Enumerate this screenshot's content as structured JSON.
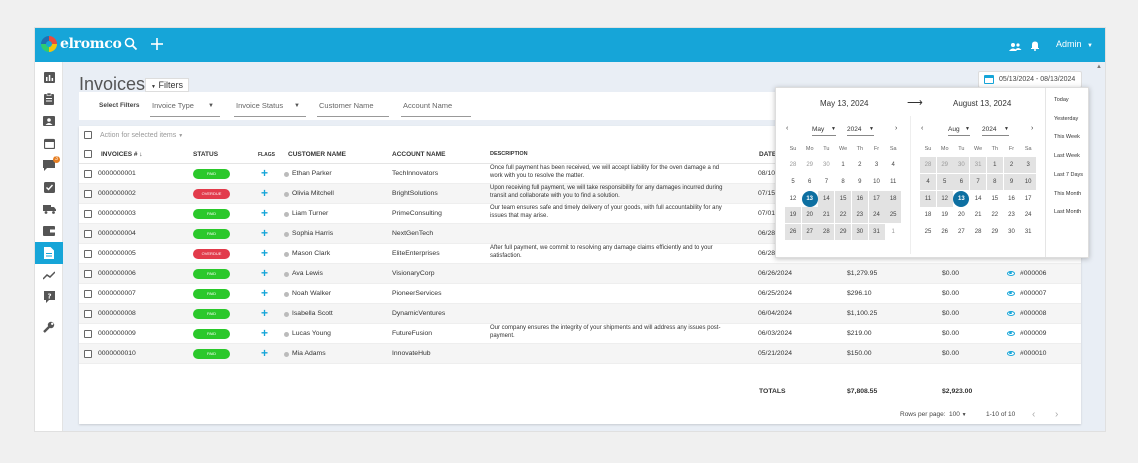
{
  "app": {
    "logo_text": "elromco",
    "admin_label": "Admin"
  },
  "icons": {
    "topbar": [
      "search-icon",
      "plus-icon",
      "users-icon",
      "bell-icon"
    ],
    "sidebar": [
      "chart-icon",
      "clipboard-icon",
      "contact-card-icon",
      "calendar-icon",
      "chat-icon",
      "checkbox-icon",
      "truck-icon",
      "wallet-icon",
      "document-icon",
      "trend-icon",
      "help-icon",
      "wrench-icon"
    ]
  },
  "sidebar": {
    "badge": "3",
    "active_index": 8
  },
  "page": {
    "title": "Invoices",
    "filters_button": "Filters"
  },
  "date_range": "05/13/2024 - 08/13/2024",
  "filters": {
    "label": "Select Filters",
    "invoice_type": "Invoice Type",
    "invoice_status": "Invoice Status",
    "customer_name": "Customer Name",
    "account_name": "Account Name"
  },
  "bulk_action": "Action for selected items",
  "columns": {
    "invoice": "INVOICES #",
    "status": "STATUS",
    "flags": "FLAGS",
    "customer": "CUSTOMER NAME",
    "account": "ACCOUNT NAME",
    "description": "DESCRIPTION",
    "date": "DATE"
  },
  "rows": [
    {
      "invoice": "0000000001",
      "status": "PAID",
      "customer": "Ethan Parker",
      "account": "TechInnovators",
      "description": "Once full payment has been received, we will accept liability for the oven damage a nd work with you to resolve the matter.",
      "date": "08/10",
      "amount": "",
      "paid": "",
      "ref": ""
    },
    {
      "invoice": "0000000002",
      "status": "OVERDUE",
      "customer": "Olivia Mitchell",
      "account": "BrightSolutions",
      "description": "Upon receiving full payment, we will take responsibility for any damages incurred during transit and collaborate with you to find a solution.",
      "date": "07/15",
      "amount": "",
      "paid": "",
      "ref": ""
    },
    {
      "invoice": "0000000003",
      "status": "PAID",
      "customer": "Liam Turner",
      "account": "PrimeConsulting",
      "description": "Our team ensures safe and timely delivery of your goods, with full accountability for any issues that may arise.",
      "date": "07/01",
      "amount": "",
      "paid": "",
      "ref": ""
    },
    {
      "invoice": "0000000004",
      "status": "PAID",
      "customer": "Sophia Harris",
      "account": "NextGenTech",
      "description": "",
      "date": "06/28",
      "amount": "",
      "paid": "",
      "ref": ""
    },
    {
      "invoice": "0000000005",
      "status": "OVERDUE",
      "customer": "Mason Clark",
      "account": "EliteEnterprises",
      "description": "After full payment, we commit to resolving any damage claims efficiently and to your satisfaction.",
      "date": "06/28",
      "amount": "",
      "paid": "",
      "ref": ""
    },
    {
      "invoice": "0000000006",
      "status": "PAID",
      "customer": "Ava Lewis",
      "account": "VisionaryCorp",
      "description": "",
      "date": "06/26/2024",
      "amount": "$1,279.95",
      "paid": "$0.00",
      "ref": "#000006"
    },
    {
      "invoice": "0000000007",
      "status": "PAID",
      "customer": "Noah Walker",
      "account": "PioneerServices",
      "description": "",
      "date": "06/25/2024",
      "amount": "$296.10",
      "paid": "$0.00",
      "ref": "#000007"
    },
    {
      "invoice": "0000000008",
      "status": "PAID",
      "customer": "Isabella Scott",
      "account": "DynamicVentures",
      "description": "",
      "date": "06/04/2024",
      "amount": "$1,100.25",
      "paid": "$0.00",
      "ref": "#000008"
    },
    {
      "invoice": "0000000009",
      "status": "PAID",
      "customer": "Lucas Young",
      "account": "FutureFusion",
      "description": "Our company ensures the integrity of your shipments and will address any issues post-payment.",
      "date": "06/03/2024",
      "amount": "$219.00",
      "paid": "$0.00",
      "ref": "#000009"
    },
    {
      "invoice": "0000000010",
      "status": "PAID",
      "customer": "Mia Adams",
      "account": "InnovateHub",
      "description": "",
      "date": "05/21/2024",
      "amount": "$150.00",
      "paid": "$0.00",
      "ref": "#000010"
    }
  ],
  "totals": {
    "label": "TOTALS",
    "amount": "$7,808.55",
    "paid": "$2,923.00"
  },
  "pagination": {
    "rows_per_page_label": "Rows per page:",
    "rows_per_page": "100",
    "range": "1-10 of 10"
  },
  "datepicker": {
    "start_label": "May 13, 2024",
    "end_label": "August 13, 2024",
    "left": {
      "month": "May",
      "year": "2024"
    },
    "right": {
      "month": "Aug",
      "year": "2024"
    },
    "weekdays": [
      "Su",
      "Mo",
      "Tu",
      "We",
      "Th",
      "Fr",
      "Sa"
    ],
    "left_days": [
      "28",
      "29",
      "30",
      "1",
      "2",
      "3",
      "4",
      "5",
      "6",
      "7",
      "8",
      "9",
      "10",
      "11",
      "12",
      "13",
      "14",
      "15",
      "16",
      "17",
      "18",
      "19",
      "20",
      "21",
      "22",
      "23",
      "24",
      "25",
      "26",
      "27",
      "28",
      "29",
      "30",
      "31",
      "1"
    ],
    "right_days": [
      "28",
      "29",
      "30",
      "31",
      "1",
      "2",
      "3",
      "4",
      "5",
      "6",
      "7",
      "8",
      "9",
      "10",
      "11",
      "12",
      "13",
      "14",
      "15",
      "16",
      "17",
      "18",
      "19",
      "20",
      "21",
      "22",
      "23",
      "24",
      "25",
      "26",
      "27",
      "28",
      "29",
      "30",
      "31"
    ],
    "left_selected_day": "13",
    "right_selected_day": "13",
    "shortcuts": [
      "Today",
      "Yesterday",
      "This Week",
      "Last Week",
      "Last 7 Days",
      "This Month",
      "Last Month"
    ]
  },
  "colors": {
    "brand": "#16a5d8",
    "paid": "#2bc82b",
    "overdue": "#e23b4b",
    "selected_day": "#0d6fa1"
  }
}
